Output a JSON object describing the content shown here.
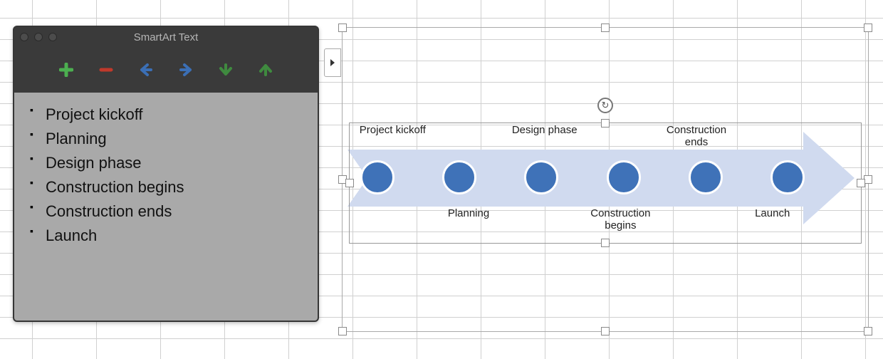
{
  "panel": {
    "title": "SmartArt Text",
    "items": [
      "Project kickoff",
      "Planning",
      "Design phase",
      "Construction begins",
      "Construction ends",
      "Launch"
    ]
  },
  "timeline": {
    "labels_top": [
      "Project kickoff",
      "",
      "Design phase",
      "",
      "Construction ends",
      ""
    ],
    "labels_bottom": [
      "",
      "Planning",
      "",
      "Construction begins",
      "",
      "Launch"
    ]
  },
  "colors": {
    "arrow_fill": "#d0daef",
    "dot_fill": "#3f72b8"
  },
  "icons": {
    "add": "plus-icon",
    "remove": "minus-icon",
    "left": "arrow-left-icon",
    "right": "arrow-right-icon",
    "down": "arrow-down-icon",
    "up": "arrow-up-icon",
    "expand": "expand-caret-icon",
    "rotate": "rotate-icon"
  }
}
